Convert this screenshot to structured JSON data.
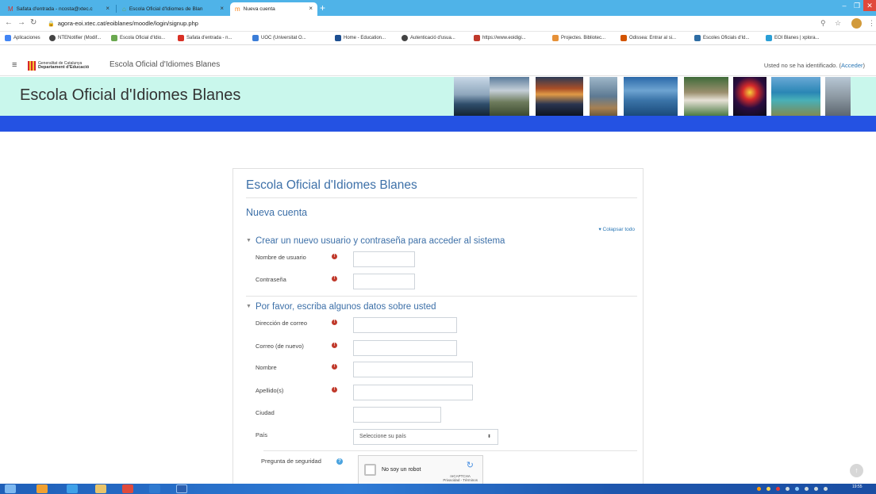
{
  "browser": {
    "tabs": [
      {
        "label": "Safata d'entrada - ncosta@xtec.c",
        "icon": "gmail-icon"
      },
      {
        "label": "Escola Oficial d'Idiomes de Blan",
        "icon": "site-icon"
      },
      {
        "label": "Nueva cuenta",
        "icon": "moodle-icon"
      }
    ],
    "url": "agora-eoi.xtec.cat/eoiblanes/moodle/login/signup.php",
    "bookmarks": [
      {
        "label": "Aplicaciones",
        "color": "#4285f4"
      },
      {
        "label": "NTENotifier (Modif...",
        "color": "#444444"
      },
      {
        "label": "Escola Oficial d'Idio...",
        "color": "#6aa84f"
      },
      {
        "label": "Safata d'entrada - n...",
        "color": "#d93025"
      },
      {
        "label": "UOC (Universitat O...",
        "color": "#3b7dd8"
      },
      {
        "label": "Home - Education...",
        "color": "#1d4f91"
      },
      {
        "label": "Autenticació d'usua...",
        "color": "#444444"
      },
      {
        "label": "https://www.eoidigi...",
        "color": "#c0392b"
      },
      {
        "label": "Projectes. Bibliotec...",
        "color": "#e69138"
      },
      {
        "label": "Odissea: Entrar al si...",
        "color": "#d35400"
      },
      {
        "label": "Escoles Oficials d'Id...",
        "color": "#2e6da4"
      },
      {
        "label": "EOI Blanes | xplora...",
        "color": "#2a9fd6"
      }
    ]
  },
  "navbar": {
    "gencat_line1": "Generalitat de Catalunya",
    "gencat_line2": "Departament d'Educació",
    "site_name": "Escola Oficial d'Idiomes Blanes",
    "login_text": "Usted no se ha identificado. (",
    "login_link": "Acceder",
    "login_close": ")"
  },
  "header": {
    "title": "Escola Oficial d'Idiomes Blanes"
  },
  "form": {
    "card_title": "Escola Oficial d'Idiomes Blanes",
    "subtitle": "Nueva cuenta",
    "collapse_all": "▾ Colapsar todo",
    "section1": "Crear un nuevo usuario y contraseña para acceder al sistema",
    "username_label": "Nombre de usuario",
    "password_label": "Contraseña",
    "section2": "Por favor, escriba algunos datos sobre usted",
    "email_label": "Dirección de correo",
    "email2_label": "Correo (de nuevo)",
    "firstname_label": "Nombre",
    "lastname_label": "Apellido(s)",
    "city_label": "Ciudad",
    "country_label": "País",
    "country_placeholder": "Seleccione su país",
    "security_label": "Pregunta de seguridad",
    "captcha_text": "No soy un robot",
    "captcha_brand": "reCAPTCHA",
    "captcha_links": "Privacidad - Términos"
  },
  "taskbar": {
    "clock": "19:55"
  }
}
